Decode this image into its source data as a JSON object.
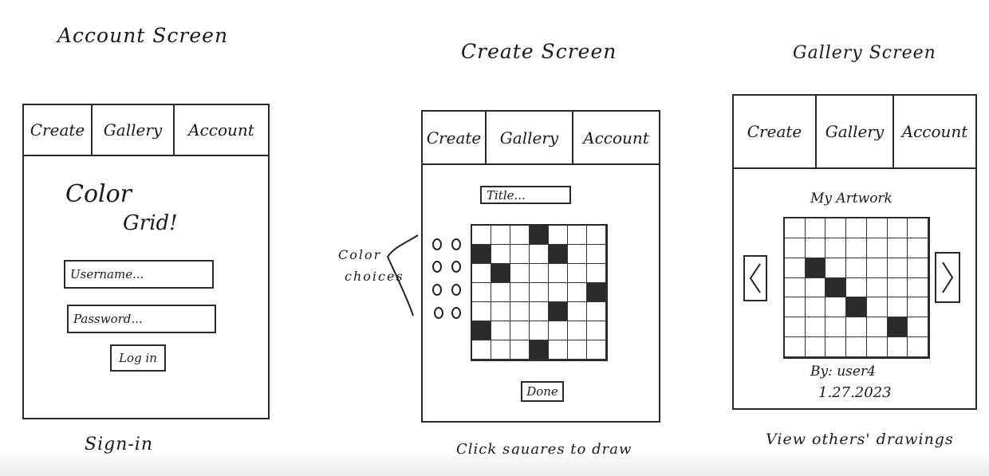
{
  "account_screen": {
    "heading": "Account Screen",
    "nav": {
      "create": "Create",
      "gallery": "Gallery",
      "account": "Account"
    },
    "app_title_line1": "Color",
    "app_title_line2": "Grid!",
    "username_placeholder": "Username...",
    "password_placeholder": "Password...",
    "login_label": "Log in",
    "caption": "Sign-in"
  },
  "create_screen": {
    "heading": "Create Screen",
    "nav": {
      "create": "Create",
      "gallery": "Gallery",
      "account": "Account"
    },
    "title_placeholder": "Title...",
    "color_choices_label_line1": "Color",
    "color_choices_label_line2": "choices",
    "filled_cells": [
      [
        0,
        3
      ],
      [
        1,
        0
      ],
      [
        1,
        4
      ],
      [
        2,
        1
      ],
      [
        3,
        6
      ],
      [
        4,
        4
      ],
      [
        5,
        0
      ],
      [
        6,
        3
      ]
    ],
    "done_label": "Done",
    "caption": "Click squares to draw"
  },
  "gallery_screen": {
    "heading": "Gallery Screen",
    "nav": {
      "create": "Create",
      "gallery": "Gallery",
      "account": "Account"
    },
    "artwork_title": "My Artwork",
    "filled_cells": [
      [
        2,
        1
      ],
      [
        3,
        2
      ],
      [
        4,
        3
      ],
      [
        5,
        5
      ]
    ],
    "author": "By: user4",
    "date": "1.27.2023",
    "caption": "View others' drawings"
  }
}
